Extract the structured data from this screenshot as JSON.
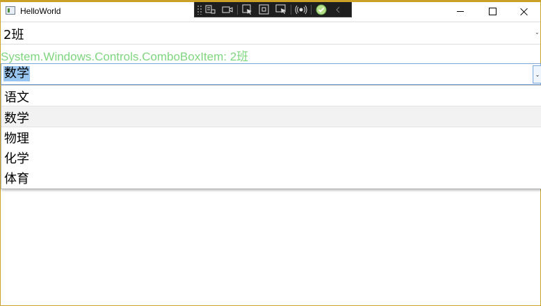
{
  "window": {
    "title": "HelloWorld",
    "accent_color": "#c9a227"
  },
  "class_combo": {
    "selected_value": "2班"
  },
  "info_line": {
    "text": "System.Windows.Controls.ComboBoxItem: 2班",
    "color": "#7ed67e"
  },
  "subject_combo": {
    "selected_value": "数学",
    "selection_color": "#99c6f0"
  },
  "subject_dropdown": {
    "items": [
      "语文",
      "数学",
      "物理",
      "化学",
      "体育"
    ],
    "highlighted_index": 1
  },
  "devtools_toolbar": {
    "icons": [
      "live-visual-tree-icon",
      "camera-icon",
      "select-element-icon",
      "display-layout-adorners-icon",
      "track-focus-icon",
      "binding-failures-icon",
      "check-icon",
      "collapse-chevron-icon"
    ]
  }
}
